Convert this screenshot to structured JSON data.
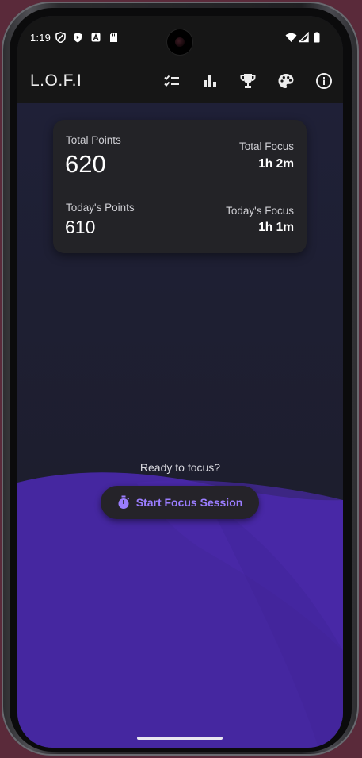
{
  "status_bar": {
    "time": "1:19",
    "left_icons": [
      "shield-icon",
      "play-protect-icon",
      "font-a-icon",
      "sd-card-icon"
    ],
    "right_icons": [
      "wifi-icon",
      "signal-icon",
      "battery-icon"
    ]
  },
  "app_bar": {
    "title": "L.O.F.I",
    "actions": [
      {
        "name": "checklist-icon"
      },
      {
        "name": "bar-chart-icon"
      },
      {
        "name": "trophy-icon"
      },
      {
        "name": "palette-icon"
      },
      {
        "name": "info-icon"
      }
    ]
  },
  "stats": {
    "total_points_label": "Total Points",
    "total_points_value": "620",
    "total_focus_label": "Total Focus",
    "total_focus_value": "1h 2m",
    "today_points_label": "Today's Points",
    "today_points_value": "610",
    "today_focus_label": "Today's Focus",
    "today_focus_value": "1h 1m"
  },
  "focus": {
    "prompt": "Ready to focus?",
    "start_button_label": "Start Focus Session",
    "start_button_icon": "stopwatch-icon"
  },
  "colors": {
    "accent": "#9b7dff",
    "wave": "#4527a0",
    "background": "#1e1f33"
  }
}
